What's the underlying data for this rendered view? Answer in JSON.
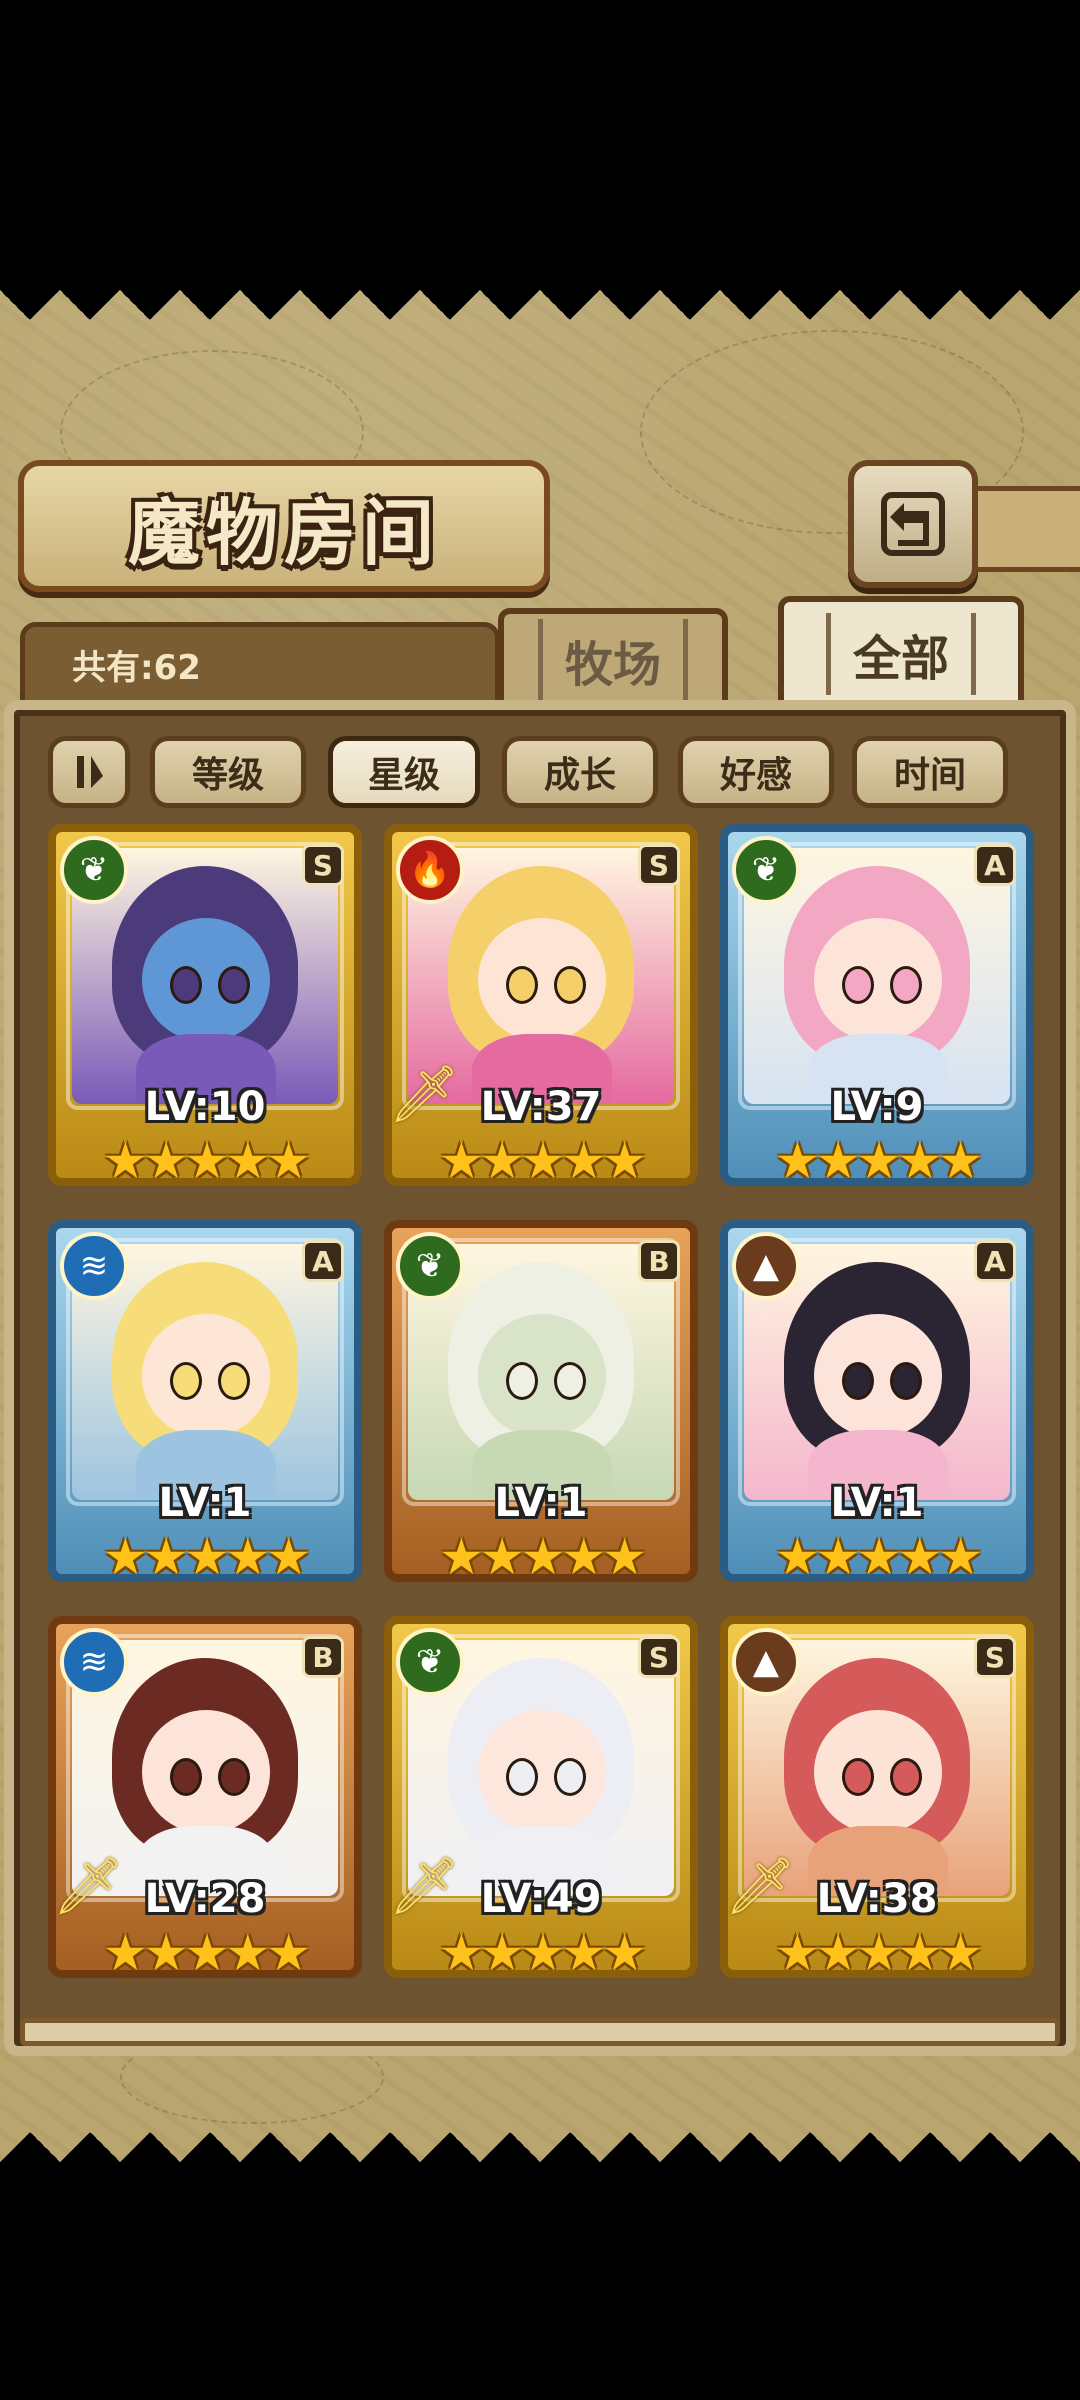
{
  "header": {
    "title": "魔物房间",
    "count_text": "共有:62"
  },
  "tabs": [
    {
      "label": "牧场",
      "active": false
    },
    {
      "label": "全部",
      "active": true
    }
  ],
  "filters": [
    {
      "label": "等级",
      "active": false
    },
    {
      "label": "星级",
      "active": true
    },
    {
      "label": "成长",
      "active": false
    },
    {
      "label": "好感",
      "active": false
    },
    {
      "label": "时间",
      "active": false
    }
  ],
  "colors": {
    "frame_gold": "#f1c84a",
    "frame_blue": "#a9d7ee",
    "frame_bronze": "#e7a35a",
    "panel_brown": "#6e5331",
    "background_map": "#b9a66f"
  },
  "monsters": [
    {
      "element": "grass",
      "element_icon": "leaf-icon",
      "rank": "S",
      "frame": "gold",
      "weapon": false,
      "level": "LV:10",
      "stars": "★★★★★",
      "star_count": 5,
      "colors": {
        "hair": "#4b3b7a",
        "skin": "#5f97d6",
        "body": "#7a5ab8"
      }
    },
    {
      "element": "fire",
      "element_icon": "flame-icon",
      "rank": "S",
      "frame": "gold",
      "weapon": true,
      "level": "LV:37",
      "stars": "★★★★★",
      "star_count": 5,
      "colors": {
        "hair": "#f5d06a",
        "skin": "#fde4d4",
        "body": "#e56aa0"
      }
    },
    {
      "element": "grass",
      "element_icon": "leaf-icon",
      "rank": "A",
      "frame": "blue",
      "weapon": false,
      "level": "LV:9",
      "stars": "★★★★★",
      "star_count": 5,
      "colors": {
        "hair": "#f2a7c3",
        "skin": "#fde4d8",
        "body": "#d7e3f2"
      }
    },
    {
      "element": "water",
      "element_icon": "wave-icon",
      "rank": "A",
      "frame": "blue",
      "weapon": false,
      "level": "LV:1",
      "stars": "★★★★★",
      "star_count": 5,
      "colors": {
        "hair": "#f7dd7a",
        "skin": "#fde6d6",
        "body": "#9cc4e0"
      }
    },
    {
      "element": "grass",
      "element_icon": "leaf-icon",
      "rank": "B",
      "frame": "bronze",
      "weapon": false,
      "level": "LV:1",
      "stars": "★★★★★",
      "star_count": 5,
      "colors": {
        "hair": "#eef0e4",
        "skin": "#d9e3c8",
        "body": "#c6d8b4"
      }
    },
    {
      "element": "earth",
      "element_icon": "mountain-icon",
      "rank": "A",
      "frame": "blue",
      "weapon": false,
      "level": "LV:1",
      "stars": "★★★★★",
      "star_count": 5,
      "colors": {
        "hair": "#2b2433",
        "skin": "#fde4da",
        "body": "#f4b6cc"
      }
    },
    {
      "element": "water",
      "element_icon": "wave-icon",
      "rank": "B",
      "frame": "bronze",
      "weapon": true,
      "level": "LV:28",
      "stars": "★★★★★",
      "star_count": 5,
      "colors": {
        "hair": "#6b2a22",
        "skin": "#fde4d8",
        "body": "#f2f2f2"
      }
    },
    {
      "element": "grass",
      "element_icon": "leaf-icon",
      "rank": "S",
      "frame": "gold",
      "weapon": true,
      "level": "LV:49",
      "stars": "★★★★★",
      "star_count": 5,
      "colors": {
        "hair": "#eceef4",
        "skin": "#fde6dc",
        "body": "#f0f0f4"
      }
    },
    {
      "element": "earth",
      "element_icon": "mountain-icon",
      "rank": "S",
      "frame": "gold",
      "weapon": true,
      "level": "LV:38",
      "stars": "★★★★★",
      "star_count": 5,
      "colors": {
        "hair": "#d55a5a",
        "skin": "#fde2d6",
        "body": "#e8a27a"
      }
    }
  ]
}
